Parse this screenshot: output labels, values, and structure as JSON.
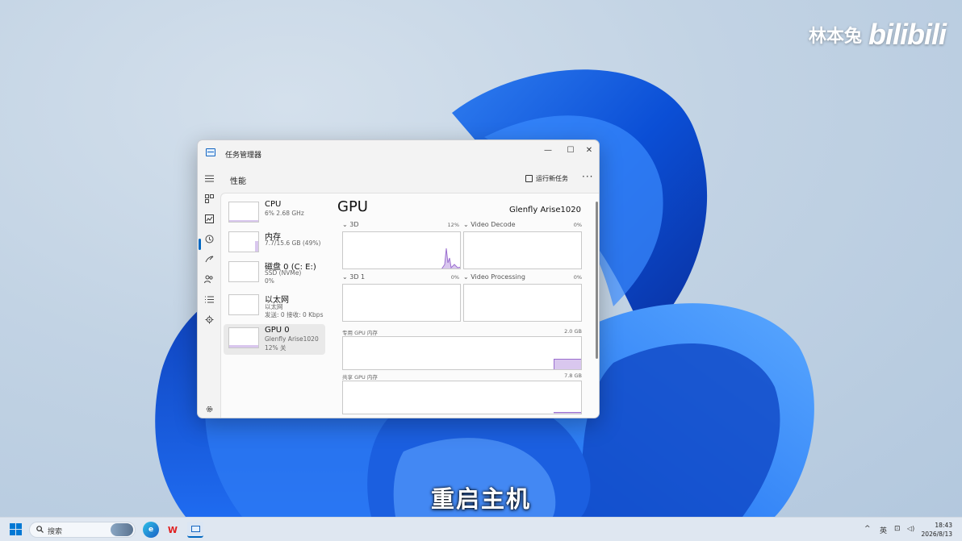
{
  "watermark": {
    "author": "林本兔",
    "brand": "bilibili"
  },
  "subtitle": "重启主机",
  "window": {
    "title": "任务管理器",
    "controls": {
      "minimize": "—",
      "maximize": "☐",
      "close": "✕"
    },
    "header": {
      "title": "性能",
      "run_task": "运行新任务",
      "more": "···"
    },
    "nav_icons": [
      "hamburger-icon",
      "processes-icon",
      "performance-icon",
      "app-history-icon",
      "startup-apps-icon",
      "users-icon",
      "details-icon",
      "services-icon",
      "settings-icon"
    ],
    "devices": [
      {
        "name": "CPU",
        "sub1": "6% 2.68 GHz",
        "sub2": "",
        "usage": 0.06
      },
      {
        "name": "内存",
        "sub1": "7.7/15.6 GB (49%)",
        "sub2": "",
        "usage": 0.49
      },
      {
        "name": "磁盘 0 (C: E:)",
        "sub1": "SSD (NVMe)",
        "sub2": "0%",
        "usage": 0.0
      },
      {
        "name": "以太网",
        "sub1": "以太网",
        "sub2": "发送: 0 接收: 0 Kbps",
        "usage": 0.0
      },
      {
        "name": "GPU 0",
        "sub1": "Glenfly Arise1020",
        "sub2": "12% 关",
        "usage": 0.12,
        "selected": true
      }
    ],
    "gpu": {
      "title": "GPU",
      "model": "Glenfly Arise1020",
      "engines": [
        {
          "label": "3D",
          "value": "12%"
        },
        {
          "label": "Video Decode",
          "value": "0%"
        },
        {
          "label": "3D 1",
          "value": "0%"
        },
        {
          "label": "Video Processing",
          "value": "0%"
        }
      ],
      "dedicated": {
        "label": "专用 GPU 内存",
        "max": "2.0 GB",
        "usage": 0.3
      },
      "shared": {
        "label": "共享 GPU 内存",
        "max": "7.8 GB",
        "usage": 0.05
      }
    },
    "colors": {
      "accent": "#0067c0",
      "graph_fill": "#d9c7ee",
      "graph_line": "#9b6fcf"
    }
  },
  "taskbar": {
    "search_placeholder": "搜索",
    "apps": [
      "edge-icon",
      "wps-icon",
      "task-manager-icon"
    ],
    "wps_label": "W",
    "tray": {
      "chevron": "^",
      "ime": "英",
      "network": "⊡",
      "volume": "◁)"
    },
    "time": "18:43",
    "date": "2026/8/13"
  }
}
